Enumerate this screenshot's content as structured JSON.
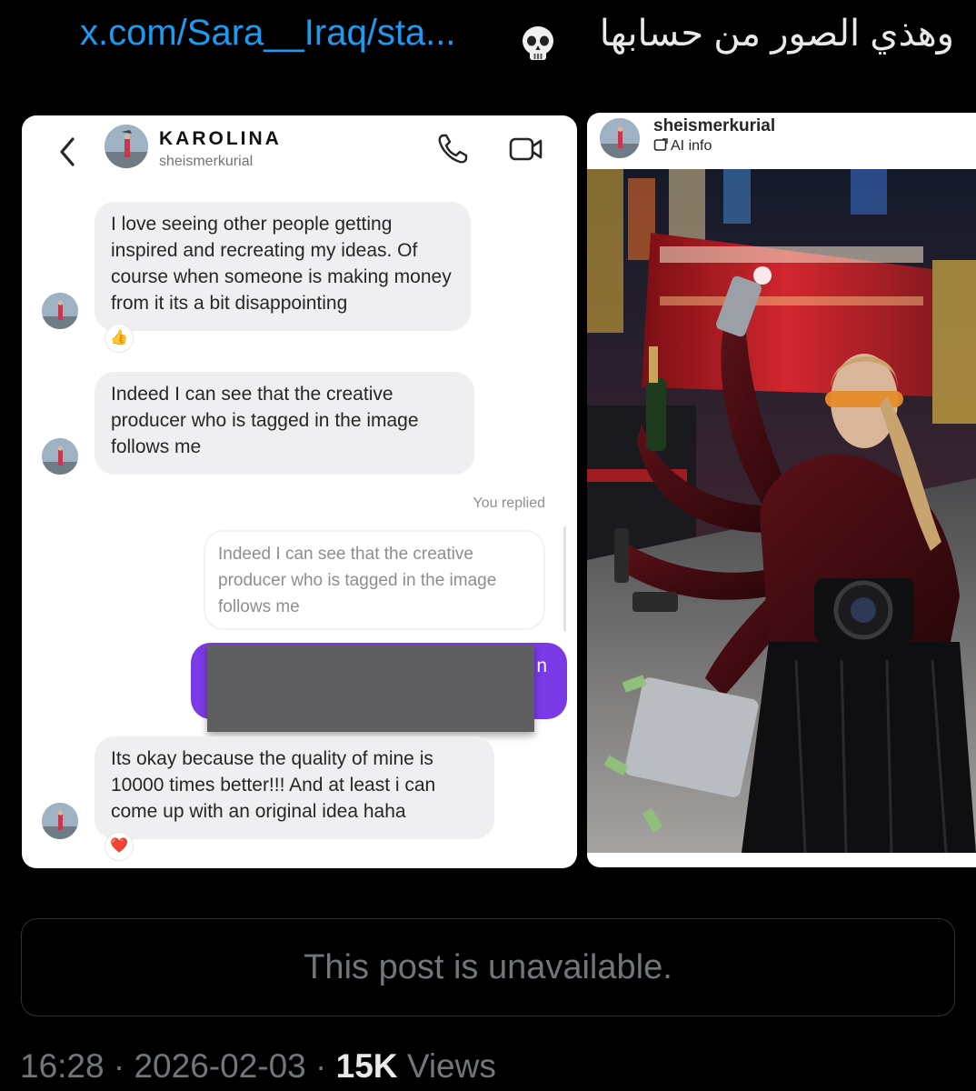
{
  "tweet": {
    "arabic_text": "وهذي الصور من حسابها",
    "link_text": "x.com/Sara__Iraq/sta...",
    "emoji": "skull-icon"
  },
  "dm": {
    "name": "KAROLINA",
    "handle": "sheismerkurial",
    "messages": [
      "I love seeing other people getting inspired and recreating my ideas. Of course when someone is making money from it its a bit disappointing",
      "Indeed I can see that the creative producer who is tagged in the image follows me",
      "Its okay because the quality of mine is 10000 times better!!! And at least i can come up with an original idea haha"
    ],
    "reactions": [
      "👍",
      "❤️"
    ],
    "you_replied": "You replied",
    "quoted": "Indeed I can see that the creative producer who is tagged in the image follows me",
    "my_message_visible_fragment": "n"
  },
  "post": {
    "handle": "sheismerkurial",
    "ai_info": "AI info"
  },
  "quote": {
    "unavailable": "This post is unavailable."
  },
  "meta": {
    "time": "16:28",
    "date": "2026-02-03",
    "views_count": "15K",
    "views_label": "Views",
    "separator": " · "
  },
  "colors": {
    "link": "#1d9bf0",
    "dm_bubble": "#efeff2",
    "my_bubble": "#7c3ae7",
    "muted": "#71767b"
  }
}
